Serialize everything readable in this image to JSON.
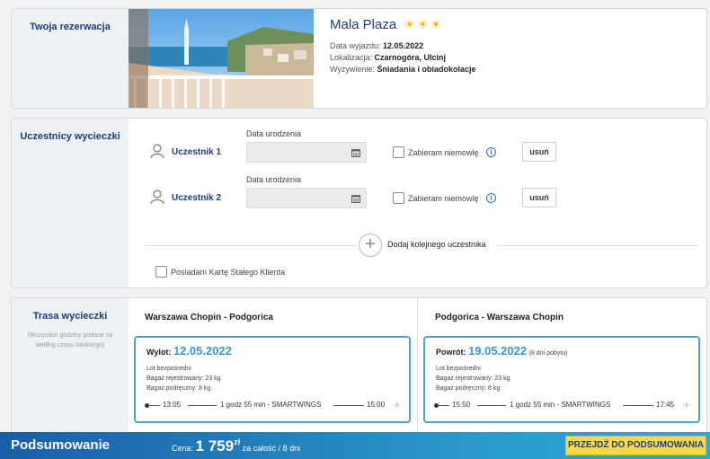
{
  "reservation": {
    "section_title": "Twoja rezerwacja",
    "hotel_name": "Mala Plaza",
    "stars": 3,
    "departure_label": "Data wyjazdu:",
    "departure_value": "12.05.2022",
    "location_label": "Lokalizacja:",
    "location_value": "Czarnogóra, Ulcinj",
    "board_label": "Wyżywienie:",
    "board_value": "Śniadania i obiadokolacje"
  },
  "participants": {
    "section_title": "Uczestnicy wycieczki",
    "items": [
      {
        "label": "Uczestnik 1",
        "dob_label": "Data urodzenia",
        "dob_value": "",
        "infant_label": "Zabieram niemowlę",
        "remove_label": "usuń"
      },
      {
        "label": "Uczestnik 2",
        "dob_label": "Data urodzenia",
        "dob_value": "",
        "infant_label": "Zabieram niemowlę",
        "remove_label": "usuń"
      }
    ],
    "add_label": "Dodaj kolejnego uczestnika",
    "loyalty_label": "Posiadam Kartę Stałego Klienta"
  },
  "route": {
    "section_title": "Trasa wycieczki",
    "note": "(Wszystkie godziny podane są według czasu lokalnego)",
    "outbound": {
      "title": "Warszawa Chopin - Podgorica",
      "head_label": "Wylot:",
      "date": "12.05.2022",
      "extra": "",
      "direct": "Lot bezpośredni",
      "checked_bag": "Bagaż rejestrowany: 23 kg",
      "hand_bag": "Bagaż podręczny: 8 kg",
      "dep_time": "13:05",
      "duration": "1 godz 55 min - SMARTWINGS",
      "arr_time": "15:00"
    },
    "return": {
      "title": "Podgorica - Warszawa Chopin",
      "head_label": "Powrót:",
      "date": "19.05.2022",
      "extra": "(8 dni pobytu)",
      "direct": "Lot bezpośredni",
      "checked_bag": "Bagaż rejestrowany: 23 kg",
      "hand_bag": "Bagaż podręczny: 8 kg",
      "dep_time": "15:50",
      "duration": "1 godz 55 min - SMARTWINGS",
      "arr_time": "17:45"
    }
  },
  "footer": {
    "summary_label": "Podsumowanie",
    "price_prefix": "Cena:",
    "price_value": "1 759",
    "currency": "zł",
    "price_suffix": "za całość / 8 dni",
    "cta_label": "PRZEJDŹ DO PODSUMOWANIA"
  },
  "colors": {
    "brand_blue": "#1a3d7c",
    "accent_blue": "#3a97d4",
    "cta_yellow": "#fbd84a",
    "sun_yellow": "#f5b800"
  }
}
